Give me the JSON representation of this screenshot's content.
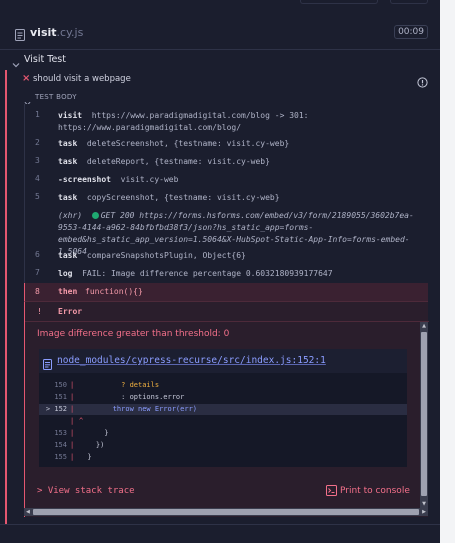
{
  "spec": {
    "name": "visit",
    "ext": ".cy.js",
    "duration": "00:09",
    "icon": "file-icon"
  },
  "suite": {
    "title": "Visit Test",
    "icon": "chevron-down-icon"
  },
  "test": {
    "title": "should visit a webpage",
    "status_icon": "x-fail-icon",
    "info_icon": "info-icon"
  },
  "test_body": {
    "label": "TEST BODY"
  },
  "commands": [
    {
      "num": "1",
      "name": "visit",
      "message": "https://www.paradigmadigital.com/blog -> 301: https://www.paradigmadigital.com/blog/"
    },
    {
      "num": "2",
      "name": "task",
      "message": "deleteScreenshot, {testname: visit.cy-web}"
    },
    {
      "num": "3",
      "name": "task",
      "message": "deleteReport, {testname: visit.cy-web}"
    },
    {
      "num": "4",
      "name": "-screenshot",
      "message": "visit.cy-web"
    },
    {
      "num": "5",
      "name": "task",
      "message": "copyScreenshot, {testname: visit.cy-web}"
    },
    {
      "num": "",
      "name": "(xhr)",
      "message": "GET 200 https://forms.hsforms.com/embed/v3/form/2189055/3602b7ea-9553-4144-a962-84bfbfbd38f3/json?hs_static_app=forms-embed&hs_static_app_version=1.5064&X-HubSpot-Static-App-Info=forms-embed-1.5064"
    },
    {
      "num": "6",
      "name": "task",
      "message": "compareSnapshotsPlugin, Object{6}"
    },
    {
      "num": "7",
      "name": "log",
      "message": "FAIL: Image difference percentage 0.6032180939177647"
    }
  ],
  "failed_command": {
    "num": "8",
    "name": "then",
    "message": "function(){}"
  },
  "error": {
    "label": "Error",
    "bang": "!",
    "message": "Image difference greater than threshold: 0",
    "file_path": "node_modules/cypress-recurse/src/index.js:152:1",
    "code_lines": [
      {
        "ln": "150",
        "bar": "|",
        "code": "          ? details"
      },
      {
        "ln": "151",
        "bar": "|",
        "code": "          : options.error"
      },
      {
        "ln": "> 152",
        "bar": "|",
        "code": "        throw new Error(err)"
      },
      {
        "ln": "",
        "bar": "|",
        "code": "^"
      },
      {
        "ln": "153",
        "bar": "|",
        "code": "      }"
      },
      {
        "ln": "154",
        "bar": "|",
        "code": "    })"
      },
      {
        "ln": "155",
        "bar": "|",
        "code": "  }"
      }
    ],
    "stack_label": "> View stack trace",
    "print_label": "Print to console",
    "print_icon": "terminal-icon"
  },
  "colors": {
    "fail": "#e45770",
    "link": "#8b9dff",
    "success_dot": "#1fa971"
  }
}
